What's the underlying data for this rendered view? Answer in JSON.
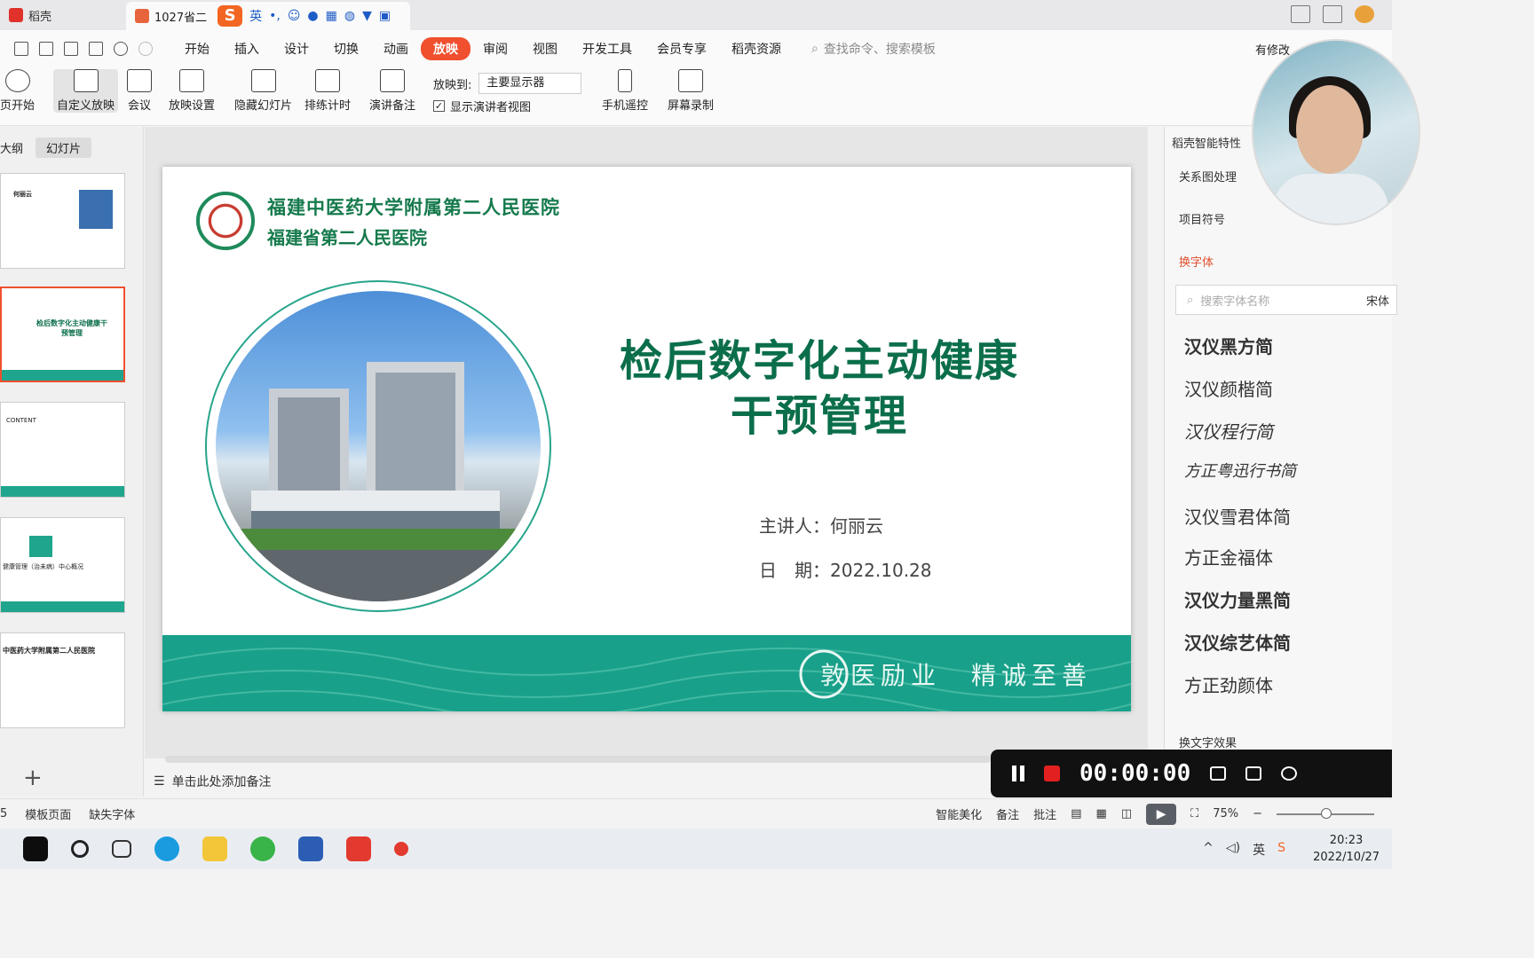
{
  "titlebar": {
    "app_tab": "稻壳",
    "doc_tab": "1027省二",
    "ime_mode": "英",
    "ime_extra": "•,"
  },
  "menu": {
    "items": [
      "开始",
      "插入",
      "设计",
      "切换",
      "动画",
      "放映",
      "审阅",
      "视图",
      "开发工具",
      "会员专享",
      "稻壳资源"
    ],
    "active": "放映",
    "search_placeholder": "查找命令、搜索模板",
    "status": "有修改"
  },
  "ribbon": {
    "buttons": [
      "页开始",
      "自定义放映",
      "会议",
      "放映设置",
      "隐藏幻灯片",
      "排练计时",
      "演讲备注",
      "手机遥控",
      "屏幕录制"
    ],
    "show_to_label": "放映到:",
    "show_to_value": "主要显示器",
    "presenter_label": "显示演讲者视图",
    "presenter_checked": "✓"
  },
  "left_panel": {
    "tab_outline": "大纲",
    "tab_slides": "幻灯片",
    "thumbs": [
      {
        "text": "何丽云"
      },
      {
        "text": "检后数字化主动健康干预管理"
      },
      {
        "text": "CONTENT"
      },
      {
        "text": "健康管理（治未病）中心概况"
      },
      {
        "text": "中医药大学附属第二人民医院"
      }
    ],
    "add_label": "+"
  },
  "slide": {
    "hospital_line1": "福建中医药大学附属第二人民医院",
    "hospital_line2": "福建省第二人民医院",
    "title_line1": "检后数字化主动健康",
    "title_line2": "干预管理",
    "speaker": "主讲人：何丽云",
    "date": "日　期：2022.10.28",
    "motto": "敦医励业　精诚至善"
  },
  "notes": {
    "placeholder": "单击此处添加备注"
  },
  "right_panel": {
    "header": "稻壳智能特性",
    "tab": "关系图处理",
    "section_bullets": "项目符号",
    "section_fonts": "换字体",
    "search_placeholder": "搜索字体名称",
    "font_selected": "宋体",
    "fonts": [
      "汉仪黑方简",
      "汉仪颜楷简",
      "汉仪程行简",
      "方正粤迅行书简",
      "汉仪雪君体简",
      "方正金福体",
      "汉仪力量黑简",
      "汉仪综艺体简",
      "方正劲颜体"
    ],
    "section_effects": "换文字效果"
  },
  "recorder": {
    "time": "00:00:00"
  },
  "statusbar": {
    "slide_num": "5",
    "template": "模板页面",
    "missing_fonts": "缺失字体",
    "beautify": "智能美化",
    "notes": "备注",
    "comments": "批注",
    "zoom": "75%"
  },
  "taskbar": {
    "time": "20:23",
    "date": "2022/10/27",
    "lang": "英"
  },
  "colors": {
    "accent": "#f0502e",
    "slide_green": "#0b6e4a",
    "band_teal": "#18a08a"
  }
}
